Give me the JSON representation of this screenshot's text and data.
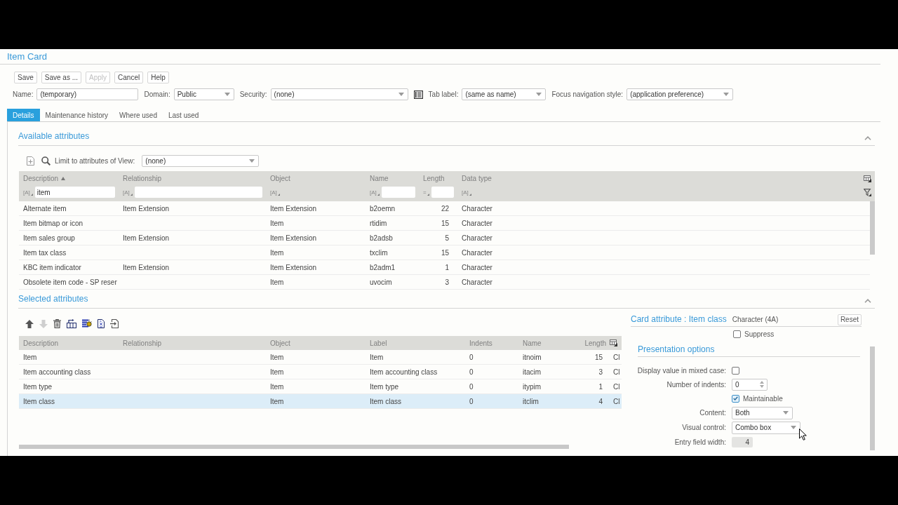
{
  "window": {
    "title": "Item Card"
  },
  "toolbar": [
    {
      "label": "Save",
      "disabled": false
    },
    {
      "label": "Save as ...",
      "disabled": false
    },
    {
      "label": "Apply",
      "disabled": true
    },
    {
      "label": "Cancel",
      "disabled": false
    },
    {
      "label": "Help",
      "disabled": false
    }
  ],
  "form": [
    {
      "kind": "text",
      "label": "Name:",
      "value": "(temporary)"
    },
    {
      "kind": "select",
      "label": "Domain:",
      "value": "Public"
    },
    {
      "kind": "select",
      "label": "Security:",
      "value": "(none)"
    },
    {
      "kind": "icon"
    },
    {
      "kind": "select",
      "label": "Tab label:",
      "value": "(same as name)"
    },
    {
      "kind": "select",
      "label": "Focus navigation style:",
      "value": "(application preference)"
    }
  ],
  "tabs": [
    {
      "label": "Details",
      "selected": true
    },
    {
      "label": "Maintenance history",
      "selected": false
    },
    {
      "label": "Where used",
      "selected": false
    },
    {
      "label": "Last used",
      "selected": false
    }
  ],
  "available_attributes": {
    "title": "Available attributes",
    "expanded": true,
    "limit": {
      "label": "Limit to attributes of View:",
      "value": "(none)"
    },
    "table": {
      "columns": [
        {
          "label": "Description",
          "sorted": true,
          "operator": "[A]",
          "filter_field": true,
          "filter_value": "item"
        },
        {
          "label": "Relationship",
          "sorted": false,
          "operator": "[A]",
          "filter_field": true
        },
        {
          "label": "Object",
          "sorted": false,
          "operator": "[A]",
          "filter_field": false
        },
        {
          "label": "Name",
          "sorted": false,
          "operator": "[A]",
          "filter_field": true
        },
        {
          "label": "Length",
          "sorted": false,
          "operator": "=",
          "filter_field": true
        },
        {
          "label": "Data type",
          "sorted": false,
          "operator": "[A]",
          "filter_field": false
        }
      ],
      "rows": [
        {
          "description": "Alternate item",
          "relationship": "Item Extension",
          "object": "Item Extension",
          "name": "b2oemn",
          "length": "22",
          "data_type": "Character"
        },
        {
          "description": "Item bitmap or icon",
          "object": "Item",
          "name": "rtidim",
          "length": "15",
          "data_type": "Character"
        },
        {
          "description": "Item sales group",
          "relationship": "Item Extension",
          "object": "Item Extension",
          "name": "b2adsb",
          "length": "5",
          "data_type": "Character"
        },
        {
          "description": "Item tax class",
          "object": "Item",
          "name": "txclim",
          "length": "15",
          "data_type": "Character"
        },
        {
          "description": "KBC item indicator",
          "relationship": "Item Extension",
          "object": "Item Extension",
          "name": "b2adm1",
          "length": "1",
          "data_type": "Character"
        },
        {
          "description": "Obsolete item code - SP reser",
          "object": "Item",
          "name": "uvocim",
          "length": "3",
          "data_type": "Character"
        }
      ]
    }
  },
  "selected_attributes": {
    "title": "Selected attributes",
    "expanded": true,
    "toolbar": [
      {
        "kind": "move-up",
        "disabled": false
      },
      {
        "kind": "move-down",
        "disabled": true
      },
      {
        "kind": "delete",
        "disabled": false
      },
      {
        "kind": "insert",
        "disabled": false
      },
      {
        "kind": "wizard",
        "disabled": false
      },
      {
        "kind": "script",
        "disabled": false
      },
      {
        "kind": "import",
        "disabled": false
      }
    ],
    "table": {
      "columns": [
        "Description",
        "Relationship",
        "Object",
        "Label",
        "Indents",
        "Name",
        "Length"
      ],
      "rows": [
        {
          "description": "Item",
          "object": "Item",
          "label": "Item",
          "indents": "0",
          "name": "itnoim",
          "length": "15",
          "column_8": "Cl",
          "selected": false
        },
        {
          "description": "Item accounting class",
          "object": "Item",
          "label": "Item accounting class",
          "indents": "0",
          "name": "itacim",
          "length": "3",
          "column_8": "Cl",
          "selected": false
        },
        {
          "description": "Item type",
          "object": "Item",
          "label": "Item type",
          "indents": "0",
          "name": "itypim",
          "length": "1",
          "column_8": "Cl",
          "selected": false
        },
        {
          "description": "Item class",
          "object": "Item",
          "label": "Item class",
          "indents": "0",
          "name": "itclim",
          "length": "4",
          "column_8": "Cl",
          "selected": true
        }
      ]
    }
  },
  "card_attribute": {
    "title": "Card attribute : Item class",
    "type": "Character (4A)",
    "reset": "Reset",
    "suppress": {
      "label": "Suppress",
      "checked": false
    },
    "section": "Presentation options",
    "fields": [
      {
        "kind": "checkbox",
        "label": "Display value in mixed case:",
        "checked": false
      },
      {
        "kind": "spin",
        "label": "Number of indents:",
        "value": "0"
      },
      {
        "kind": "checkbox-inline",
        "label": "Maintainable",
        "checked": true
      },
      {
        "kind": "select",
        "label": "Content:",
        "value": "Both"
      },
      {
        "kind": "select",
        "label": "Visual control:",
        "value": "Combo box"
      },
      {
        "kind": "readonly",
        "label": "Entry field width:",
        "value": "4"
      }
    ]
  }
}
